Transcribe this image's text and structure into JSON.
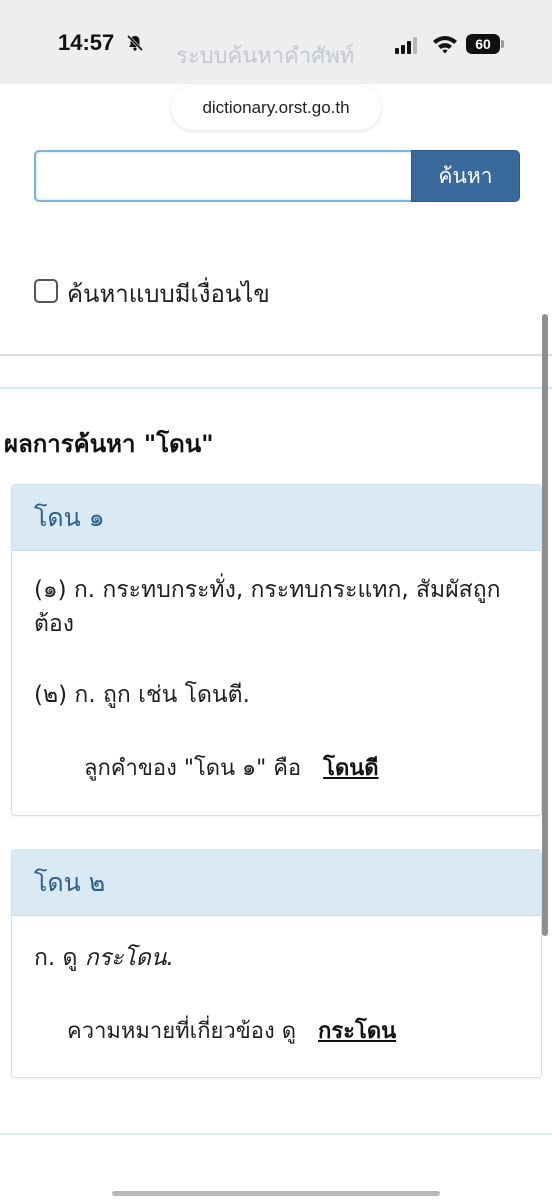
{
  "status_bar": {
    "time": "14:57",
    "battery": "60",
    "ghost_title": "ระบบค้นหาคำศัพท์"
  },
  "browser": {
    "url": "dictionary.orst.go.th"
  },
  "search": {
    "input_value": "",
    "button_label": "ค้นหา",
    "condition_label": "ค้นหาแบบมีเงื่อนไข"
  },
  "results": {
    "heading": "ผลการค้นหา \"โดน\"",
    "entries": [
      {
        "title": "โดน ๑",
        "definitions": [
          "(๑) ก. กระทบกระทั่ง, กระทบกระแทก, สัมผัสถูกต้อง",
          "(๒) ก. ถูก เช่น โดนตี."
        ],
        "derived_label": "ลูกคำของ \"โดน ๑\" คือ",
        "derived_link": "โดนดี"
      },
      {
        "title": "โดน ๒",
        "definition_prefix": "ก. ดู ",
        "definition_italic": "กระโดน.",
        "related_label": "ความหมายที่เกี่ยวข้อง ดู",
        "related_link": "กระโดน"
      }
    ]
  },
  "icons": {
    "bell": "bell-slash-icon",
    "signal": "cellular-signal-icon",
    "wifi": "wifi-icon",
    "battery": "battery-icon"
  },
  "colors": {
    "accent": "#3a6a9c",
    "card_header_bg": "#d9eaf4",
    "card_header_text": "#2d5f8a",
    "input_border": "#7fb2dc"
  }
}
